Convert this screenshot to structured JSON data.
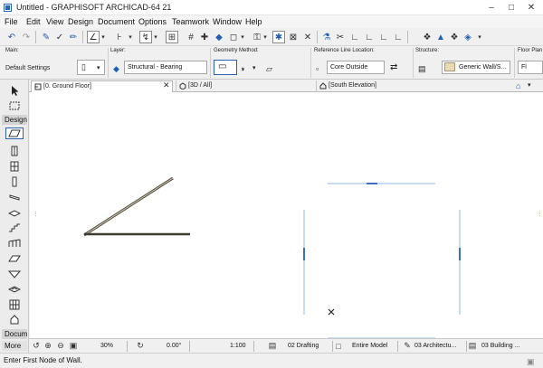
{
  "window": {
    "title": "Untitled - GRAPHISOFT ARCHICAD-64 21"
  },
  "menubar": {
    "items": [
      "File",
      "Edit",
      "View",
      "Design",
      "Document",
      "Options",
      "Teamwork",
      "Window",
      "Help"
    ]
  },
  "infobox": {
    "main_label": "Main:",
    "default_settings": "Default Settings",
    "layer_label": "Layer:",
    "layer_value": "Structural - Bearing",
    "geometry_label": "Geometry Method:",
    "refline_label": "Reference Line Location:",
    "refline_value": "Core Outside",
    "structure_label": "Structure:",
    "structure_value": "Generic Wall/S...",
    "floorplan_label": "Floor Plan",
    "floorplan_value": "Fl"
  },
  "toolbox": {
    "design_label": "Design",
    "document_label": "Docum",
    "more_label": "More"
  },
  "tabs": [
    {
      "label": "[0. Ground Floor]",
      "active": true
    },
    {
      "label": "[3D / All]",
      "active": false
    },
    {
      "label": "[South Elevation]",
      "active": false
    }
  ],
  "statusbar": {
    "zoom": "30%",
    "angle": "0.00°",
    "scale": "1:100",
    "layer_combo": "02 Drafting",
    "model_view": "Entire Model",
    "pen_set": "03 Architectu...",
    "dimension": "03 Building ..."
  },
  "prompt": "Enter First Node of Wall.",
  "colors": {
    "selection_accent": "#2a62b8",
    "drawing_line": "#55503f",
    "elevation_line": "#8fb8ea"
  }
}
